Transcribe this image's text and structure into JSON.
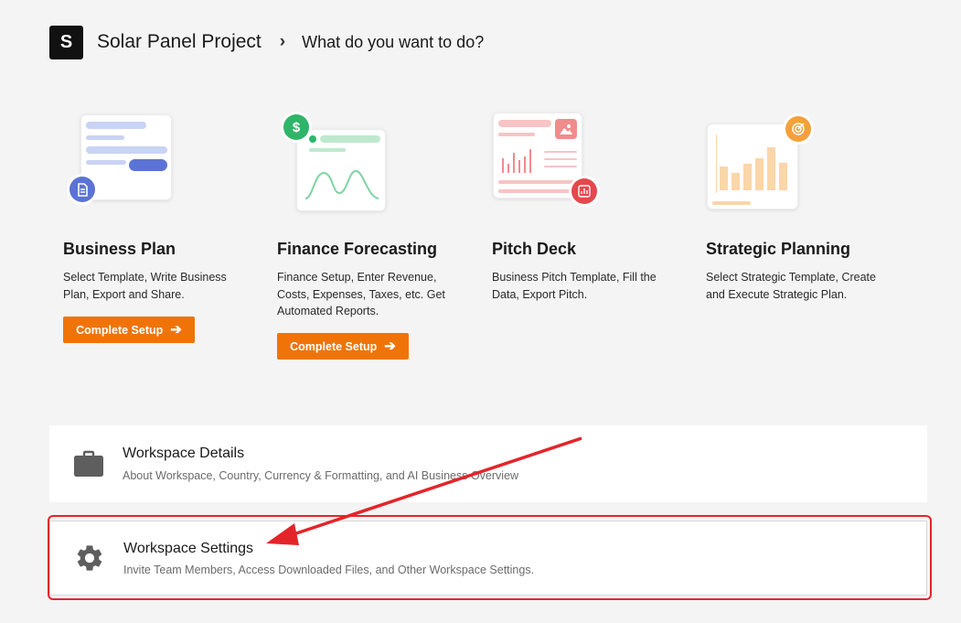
{
  "header": {
    "logo_letter": "S",
    "project_title": "Solar Panel Project",
    "separator": "›",
    "question": "What do you want to do?"
  },
  "cards": [
    {
      "title": "Business Plan",
      "description": "Select Template, Write Business Plan, Export and Share.",
      "button_label": "Complete Setup",
      "icon": "document-icon",
      "badge_color": "#5b73d6"
    },
    {
      "title": "Finance Forecasting",
      "description": "Finance Setup, Enter Revenue, Costs, Expenses, Taxes, etc. Get Automated Reports.",
      "button_label": "Complete Setup",
      "icon": "dollar-icon",
      "badge_color": "#2fb56a"
    },
    {
      "title": "Pitch Deck",
      "description": "Business Pitch Template, Fill the Data, Export Pitch.",
      "icon": "presentation-icon",
      "badge_color": "#e5484d"
    },
    {
      "title": "Strategic Planning",
      "description": "Select Strategic Template, Create and Execute Strategic Plan.",
      "icon": "target-icon",
      "badge_color": "#f5a03a"
    }
  ],
  "rows": [
    {
      "title": "Workspace Details",
      "subtitle": "About Workspace, Country, Currency & Formatting, and AI Business Overview",
      "icon": "briefcase-icon"
    },
    {
      "title": "Workspace Settings",
      "subtitle": "Invite Team Members, Access Downloaded Files, and Other Workspace Settings.",
      "icon": "gear-icon"
    }
  ],
  "colors": {
    "accent": "#f07308",
    "annotation": "#e3252a",
    "background": "#f4f4f4"
  }
}
